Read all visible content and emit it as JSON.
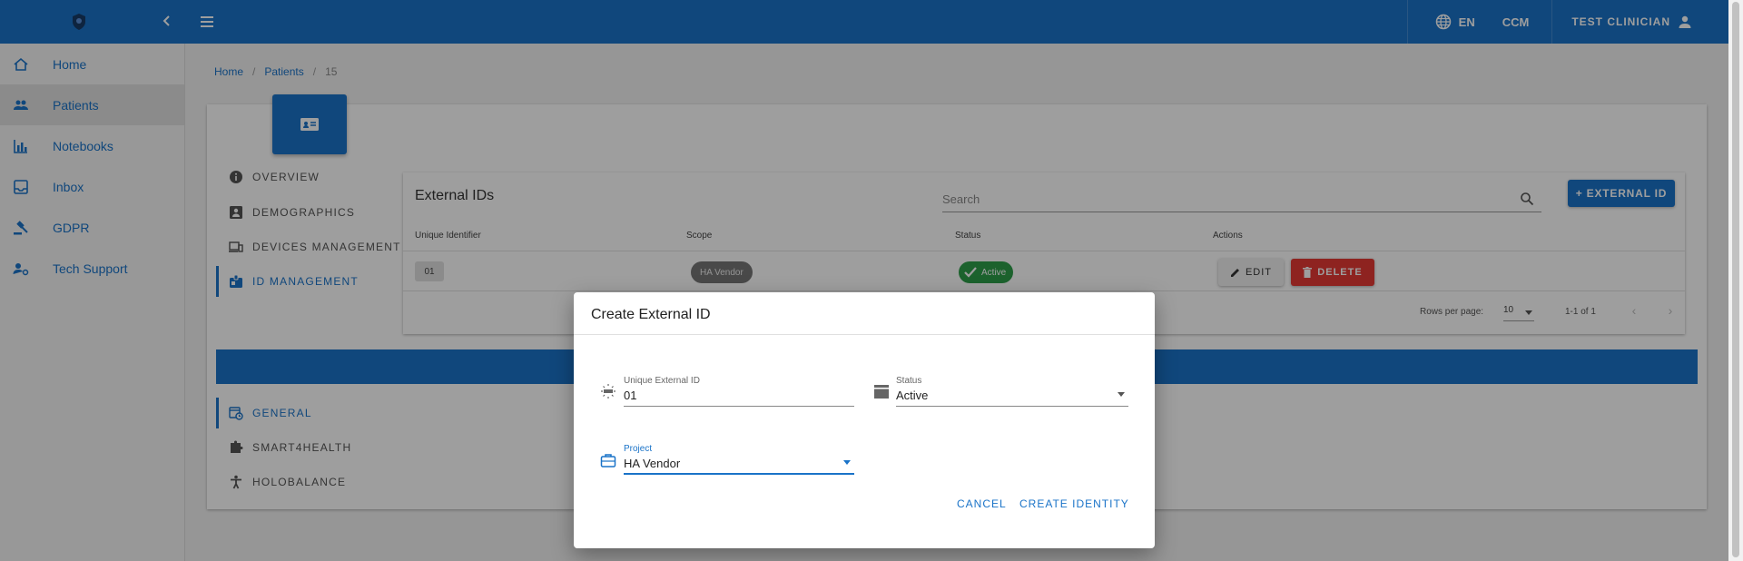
{
  "topbar": {
    "language": "EN",
    "app": "CCM",
    "user": "TEST CLINICIAN"
  },
  "sidebar": {
    "items": [
      {
        "label": "Home"
      },
      {
        "label": "Patients"
      },
      {
        "label": "Notebooks"
      },
      {
        "label": "Inbox"
      },
      {
        "label": "GDPR"
      },
      {
        "label": "Tech Support"
      }
    ]
  },
  "breadcrumb": {
    "home": "Home",
    "patients": "Patients",
    "current": "15"
  },
  "tabs": {
    "overview": "OVERVIEW",
    "demographics": "DEMOGRAPHICS",
    "devices": "DEVICES MANAGEMENT",
    "id_management": "ID MANAGEMENT",
    "general": "GENERAL",
    "smart4health": "SMART4HEALTH",
    "holobalance": "HOLOBALANCE"
  },
  "external_ids": {
    "title": "External IDs",
    "search_placeholder": "Search",
    "add_button": "+ EXTERNAL ID",
    "columns": [
      "Unique Identifier",
      "Scope",
      "Status",
      "Actions"
    ],
    "row": {
      "id": "01",
      "scope": "HA Vendor",
      "status": "Active",
      "edit": "EDIT",
      "delete": "DELETE"
    },
    "rows_per_page_label": "Rows per page:",
    "rows_per_page": "10",
    "range": "1-1 of 1"
  },
  "dialog": {
    "title": "Create External ID",
    "unique_id_label": "Unique External ID",
    "unique_id_value": "01",
    "status_label": "Status",
    "status_value": "Active",
    "project_label": "Project",
    "project_value": "HA Vendor",
    "cancel": "CANCEL",
    "create": "CREATE IDENTITY"
  },
  "colors": {
    "primary": "#1a73c8",
    "success": "#2e9e4a",
    "danger": "#e53935"
  }
}
